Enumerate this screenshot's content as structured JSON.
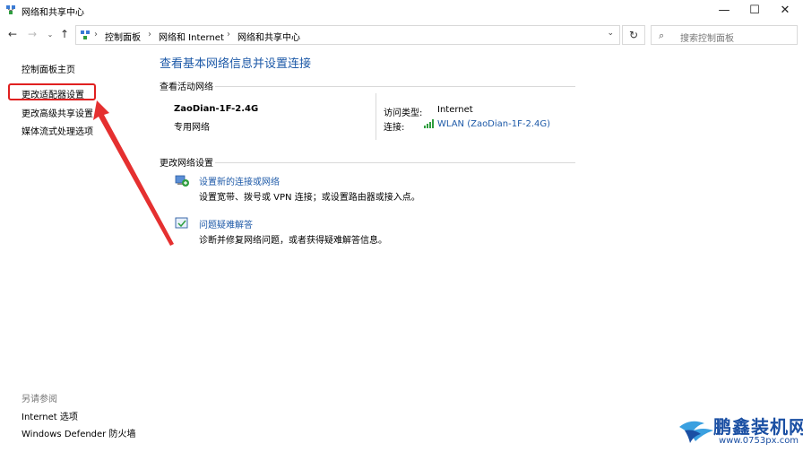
{
  "window": {
    "title": "网络和共享中心",
    "minimize": "—",
    "maximize": "☐",
    "close": "✕"
  },
  "address": {
    "crumbs": [
      "控制面板",
      "网络和 Internet",
      "网络和共享中心"
    ],
    "search_placeholder": "搜索控制面板"
  },
  "sidebar": {
    "items": [
      {
        "label": "控制面板主页"
      },
      {
        "label": "更改适配器设置"
      },
      {
        "label": "更改高级共享设置"
      },
      {
        "label": "媒体流式处理选项"
      }
    ],
    "see_also_label": "另请参阅",
    "see_also": [
      {
        "label": "Internet 选项"
      },
      {
        "label": "Windows Defender 防火墙"
      }
    ]
  },
  "main": {
    "title": "查看基本网络信息并设置连接",
    "active_networks_label": "查看活动网络",
    "network": {
      "name": "ZaoDian-1F-2.4G",
      "type": "专用网络",
      "access_type_label": "访问类型:",
      "access_type_value": "Internet",
      "connection_label": "连接:",
      "connection_value": "WLAN (ZaoDian-1F-2.4G)"
    },
    "change_settings_label": "更改网络设置",
    "tasks": [
      {
        "link": "设置新的连接或网络",
        "desc": "设置宽带、拨号或 VPN 连接；或设置路由器或接入点。"
      },
      {
        "link": "问题疑难解答",
        "desc": "诊断并修复网络问题，或者获得疑难解答信息。"
      }
    ]
  },
  "watermark": {
    "title": "鹏鑫装机网",
    "url": "www.0753px.com"
  },
  "colors": {
    "link": "#1e5aa8",
    "highlight": "#e02020",
    "watermark": "#1a4fa3"
  }
}
